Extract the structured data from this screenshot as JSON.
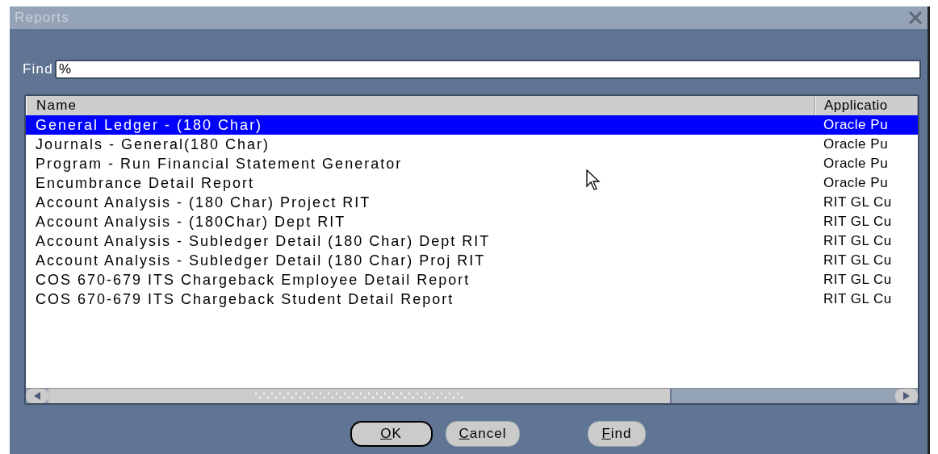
{
  "window": {
    "title": "Reports"
  },
  "find": {
    "label": "Find",
    "value": "%"
  },
  "table": {
    "columns": [
      "Name",
      "Applicatio"
    ],
    "rows": [
      {
        "name": "General Ledger - (180 Char)",
        "application": "Oracle Pu",
        "selected": true
      },
      {
        "name": "Journals - General(180 Char)",
        "application": "Oracle Pu",
        "selected": false
      },
      {
        "name": "Program - Run Financial Statement Generator",
        "application": "Oracle Pu",
        "selected": false
      },
      {
        "name": "Encumbrance Detail Report",
        "application": "Oracle Pu",
        "selected": false
      },
      {
        "name": "Account Analysis - (180 Char) Project RIT",
        "application": "RIT GL Cu",
        "selected": false
      },
      {
        "name": "Account Analysis - (180Char) Dept RIT",
        "application": "RIT GL Cu",
        "selected": false
      },
      {
        "name": "Account Analysis - Subledger Detail (180 Char) Dept RIT",
        "application": "RIT GL Cu",
        "selected": false
      },
      {
        "name": "Account Analysis - Subledger Detail (180 Char) Proj RIT",
        "application": "RIT GL Cu",
        "selected": false
      },
      {
        "name": "COS 670-679 ITS Chargeback Employee Detail Report",
        "application": "RIT GL Cu",
        "selected": false
      },
      {
        "name": "COS 670-679 ITS Chargeback Student Detail Report",
        "application": "RIT GL Cu",
        "selected": false
      }
    ]
  },
  "buttons": [
    {
      "label": "OK",
      "kind": "default"
    },
    {
      "label": "Cancel",
      "kind": "normal"
    },
    {
      "label": "Find",
      "kind": "normal"
    }
  ]
}
